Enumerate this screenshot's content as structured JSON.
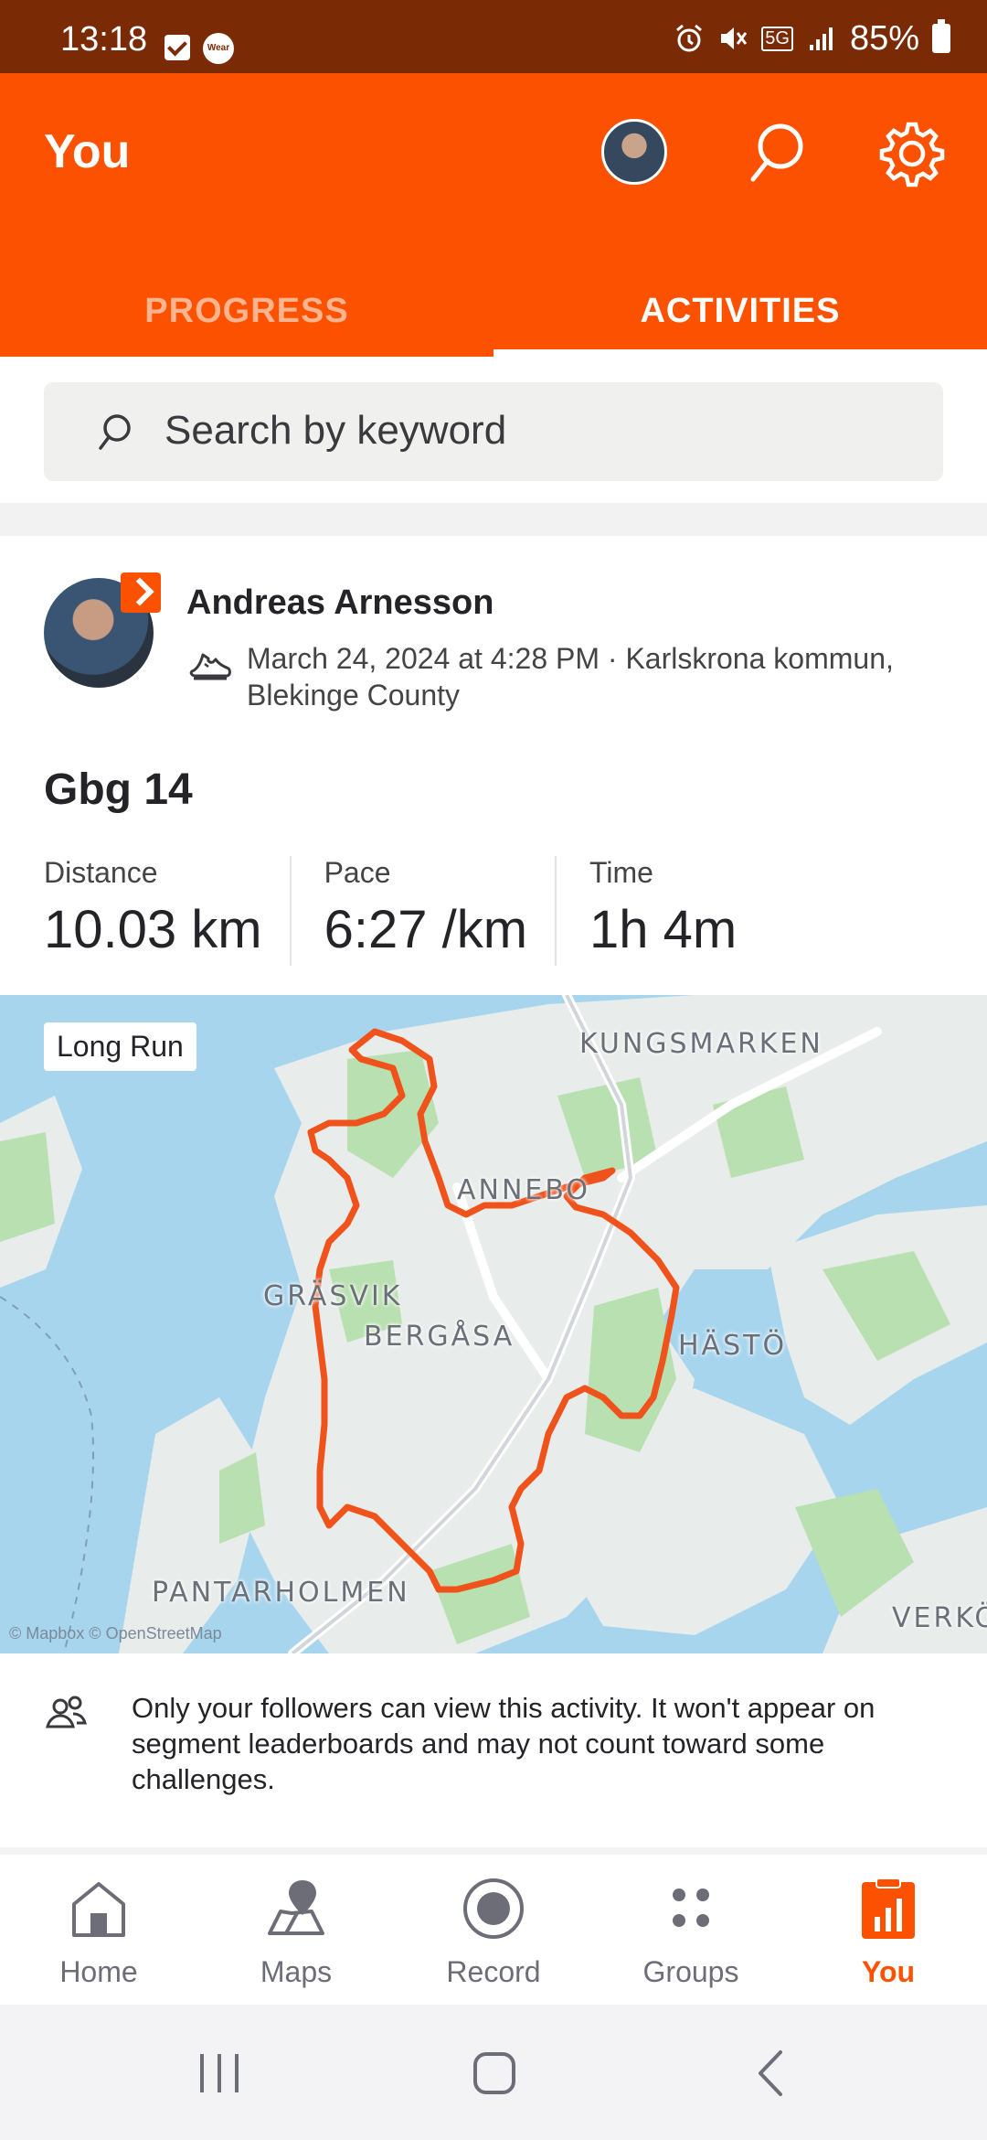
{
  "status_bar": {
    "time": "13:18",
    "wear_label": "Wear",
    "network": "5G",
    "battery": "85%"
  },
  "header": {
    "title": "You",
    "tabs": [
      {
        "label": "PROGRESS",
        "active": false
      },
      {
        "label": "ACTIVITIES",
        "active": true
      }
    ]
  },
  "search": {
    "placeholder": "Search by keyword"
  },
  "activity": {
    "athlete": "Andreas Arnesson",
    "meta": "March 24, 2024 at 4:28 PM · Karlskrona kommun, Blekinge County",
    "title": "Gbg 14",
    "stats": [
      {
        "label": "Distance",
        "value": "10.03 km"
      },
      {
        "label": "Pace",
        "value": "6:27 /km"
      },
      {
        "label": "Time",
        "value": "1h 4m"
      }
    ],
    "map": {
      "tag": "Long Run",
      "places": [
        "KUNGSMARKEN",
        "ANNEBO",
        "GRÄSVIK",
        "BERGÅSA",
        "HÄSTÖ",
        "PANTARHOLMEN",
        "VERKÖ"
      ],
      "attribution": "© Mapbox © OpenStreetMap",
      "route_color": "#f0521c"
    },
    "privacy_note": "Only your followers can view this activity. It won't appear on segment leaderboards and may not count toward some challenges."
  },
  "bottom_nav": [
    {
      "label": "Home",
      "icon": "home-icon",
      "active": false
    },
    {
      "label": "Maps",
      "icon": "map-pin-icon",
      "active": false
    },
    {
      "label": "Record",
      "icon": "record-icon",
      "active": false
    },
    {
      "label": "Groups",
      "icon": "groups-icon",
      "active": false
    },
    {
      "label": "You",
      "icon": "clipboard-chart-icon",
      "active": true
    }
  ],
  "colors": {
    "brand": "#fc5200",
    "status_bar": "#7a2a05"
  }
}
